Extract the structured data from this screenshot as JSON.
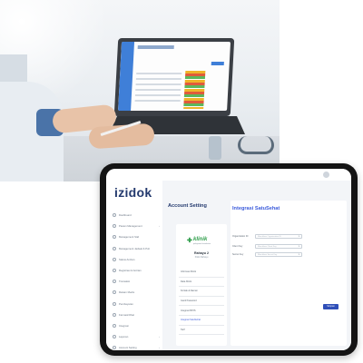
{
  "app": {
    "logo": "izidok"
  },
  "sidebar": {
    "items": [
      {
        "label": "Dashboard",
        "has_submenu": false,
        "active": false
      },
      {
        "label": "Pasien Management",
        "has_submenu": true,
        "active": false
      },
      {
        "label": "Management Staf",
        "has_submenu": false,
        "active": false
      },
      {
        "label": "Management Jadwal & Poli",
        "has_submenu": false,
        "active": false
      },
      {
        "label": "Status Antrian",
        "has_submenu": false,
        "active": false
      },
      {
        "label": "Registrasi & Antrian",
        "has_submenu": false,
        "active": false
      },
      {
        "label": "Transaksi",
        "has_submenu": false,
        "active": false
      },
      {
        "label": "Rekam Medis",
        "has_submenu": false,
        "active": false
      },
      {
        "label": "Pembayaran",
        "has_submenu": false,
        "active": false
      },
      {
        "label": "Farmasi/Obat",
        "has_submenu": false,
        "active": false
      },
      {
        "label": "Integrasi",
        "has_submenu": false,
        "active": false
      },
      {
        "label": "Laporan",
        "has_submenu": true,
        "active": false
      },
      {
        "label": "Account Setting",
        "has_submenu": true,
        "active": false
      },
      {
        "label": "Pengaturan",
        "has_submenu": false,
        "active": true
      },
      {
        "label": "Setting",
        "has_submenu": true,
        "active": false
      }
    ]
  },
  "main": {
    "page_title": "Account Setting",
    "profile": {
      "logo_text": "klinik",
      "logo_tagline": "pelayanan kesehatan",
      "clinic_name": "Rahayu 2",
      "clinic_sub": "Klinik Rahayu",
      "menu": [
        {
          "label": "Informasi Klinik",
          "active": false
        },
        {
          "label": "Data Klinik",
          "active": false
        },
        {
          "label": "Kontak & Alamat",
          "active": false
        },
        {
          "label": "Ganti Password",
          "active": false
        },
        {
          "label": "Integrasi BPJS",
          "active": false
        },
        {
          "label": "Integrasi SatuSehat",
          "active": true
        },
        {
          "label": "Tarif",
          "active": false
        }
      ]
    },
    "form": {
      "title": "Integrasi SatuSehat",
      "fields": [
        {
          "label": "Organization ID",
          "placeholder": "Masukkan Organization ID"
        },
        {
          "label": "Client Key",
          "placeholder": "Masukkan Client Key"
        },
        {
          "label": "Secret Key",
          "placeholder": "Masukkan Secret Key"
        }
      ],
      "save_label": "Simpan"
    }
  },
  "colors": {
    "brand": "#243a6e",
    "accent": "#3b5bdb",
    "klinik_green": "#2e9d4a"
  }
}
